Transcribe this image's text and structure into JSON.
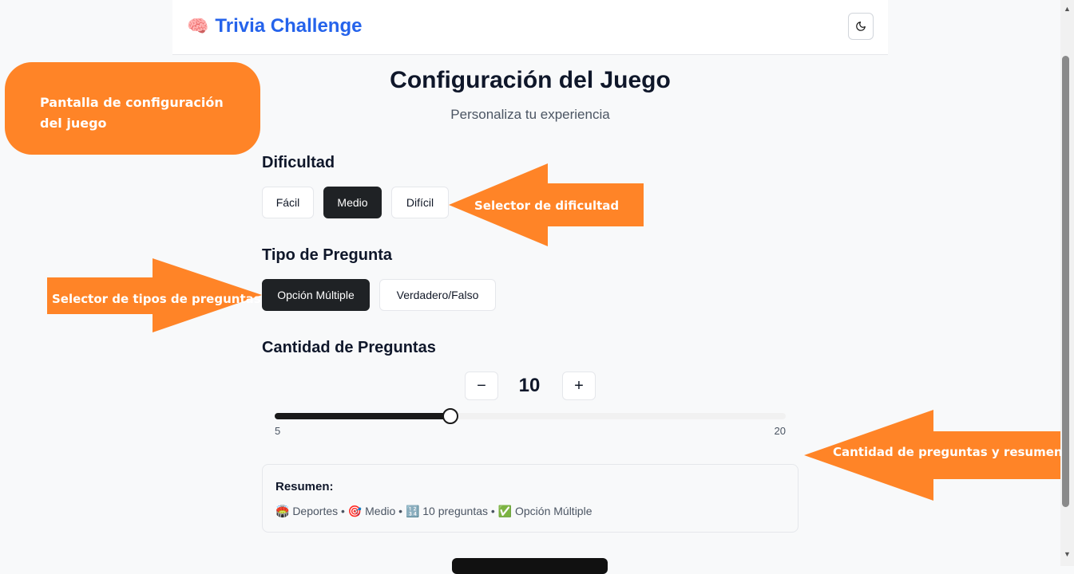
{
  "header": {
    "brand_icon": "🧠",
    "brand_title": "Trivia Challenge",
    "theme_toggle_icon": "moon-icon"
  },
  "page": {
    "title": "Configuración del Juego",
    "subtitle": "Personaliza tu experiencia"
  },
  "difficulty": {
    "label": "Dificultad",
    "options": [
      "Fácil",
      "Medio",
      "Difícil"
    ],
    "selected": "Medio"
  },
  "question_type": {
    "label": "Tipo de Pregunta",
    "options": [
      "Opción Múltiple",
      "Verdadero/Falso"
    ],
    "selected": "Opción Múltiple"
  },
  "quantity": {
    "label": "Cantidad de Preguntas",
    "minus_label": "−",
    "plus_label": "+",
    "value": "10",
    "min_label": "5",
    "max_label": "20",
    "slider_fraction": 0.34
  },
  "summary": {
    "title": "Resumen:",
    "line": "🏟️ Deportes • 🎯 Medio • 🔢 10 preguntas • ✅ Opción Múltiple"
  },
  "annotations": {
    "screen": "Pantalla de configuración del juego",
    "difficulty": "Selector de dificultad",
    "question_types": "Selector de tipos de preguntas",
    "quantity": "Cantidad de preguntas y resumen",
    "color": "#ff8427"
  },
  "colors": {
    "brand": "#2563eb",
    "active_button": "#1f2225"
  }
}
